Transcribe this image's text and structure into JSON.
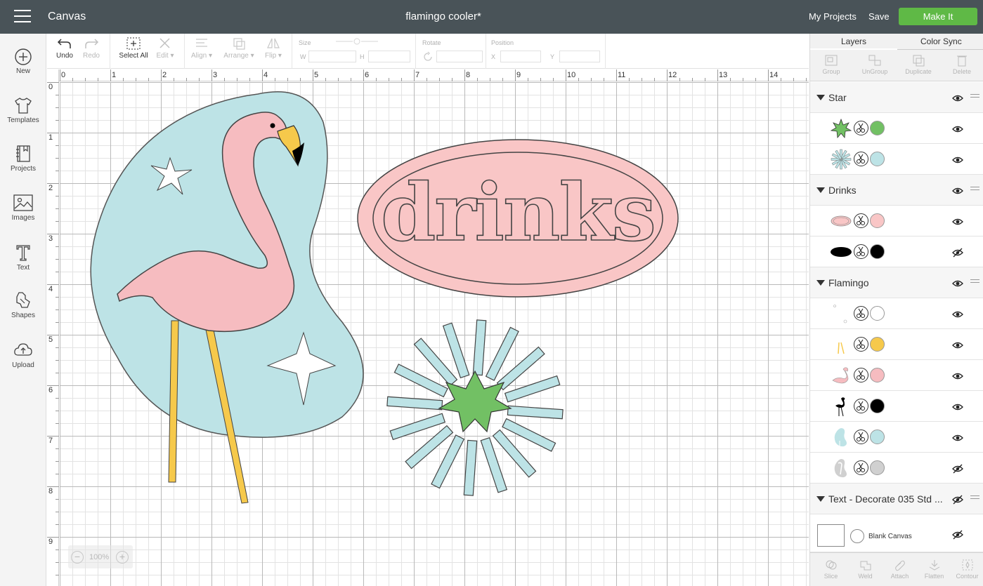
{
  "topbar": {
    "app_title": "Canvas",
    "doc_title": "flamingo cooler*",
    "my_projects": "My Projects",
    "save": "Save",
    "make_it": "Make It"
  },
  "left_nav": [
    {
      "label": "New",
      "icon": "plus-circle-icon"
    },
    {
      "label": "Templates",
      "icon": "tshirt-icon"
    },
    {
      "label": "Projects",
      "icon": "book-icon"
    },
    {
      "label": "Images",
      "icon": "image-icon"
    },
    {
      "label": "Text",
      "icon": "text-t-icon"
    },
    {
      "label": "Shapes",
      "icon": "shapes-icon"
    },
    {
      "label": "Upload",
      "icon": "cloud-upload-icon"
    }
  ],
  "toolbar": {
    "undo": "Undo",
    "redo": "Redo",
    "select_all": "Select All",
    "edit": "Edit",
    "align": "Align",
    "arrange": "Arrange",
    "flip": "Flip",
    "size": "Size",
    "w": "W",
    "h": "H",
    "rotate": "Rotate",
    "position": "Position",
    "x": "X",
    "y": "Y"
  },
  "canvas": {
    "ruler_top": [
      "0",
      "1",
      "2",
      "3",
      "4",
      "5",
      "6",
      "7",
      "8",
      "9",
      "10",
      "11",
      "12",
      "13",
      "14"
    ],
    "ruler_left": [
      "0",
      "1",
      "2",
      "3",
      "4",
      "5",
      "6",
      "7",
      "8",
      "9"
    ],
    "drinks_text": "drinks",
    "zoom_level": "100%",
    "colors": {
      "blob": "#bde3e6",
      "flamingo": "#f6bcc0",
      "beak": "#f6c94b",
      "legs": "#f6c94b",
      "drinks": "#f9c6c6",
      "burst": "#bde3e6",
      "star": "#72c064"
    }
  },
  "right_panel": {
    "tabs": [
      "Layers",
      "Color Sync"
    ],
    "actions": [
      "Group",
      "UnGroup",
      "Duplicate",
      "Delete"
    ],
    "groups": [
      {
        "name": "Star",
        "children": [
          {
            "thumb": "green-star",
            "color": "#72c064",
            "hidden": false
          },
          {
            "thumb": "blue-burst",
            "color": "#bde3e6",
            "hidden": false
          }
        ]
      },
      {
        "name": "Drinks",
        "children": [
          {
            "thumb": "drinks-oval",
            "color": "#f9c6c6",
            "hidden": false
          },
          {
            "thumb": "black-oval",
            "color": "#000000",
            "hidden": true
          }
        ]
      },
      {
        "name": "Flamingo",
        "children": [
          {
            "thumb": "white-stars",
            "color": "#ffffff",
            "hidden": false
          },
          {
            "thumb": "yellow-legs",
            "color": "#f6c94b",
            "hidden": false
          },
          {
            "thumb": "pink-flamingo",
            "color": "#f6bcc0",
            "hidden": false
          },
          {
            "thumb": "black-flamingo",
            "color": "#000000",
            "hidden": false
          },
          {
            "thumb": "blue-blob",
            "color": "#bde3e6",
            "hidden": false
          },
          {
            "thumb": "gray-blob",
            "color": "#d0d0d0",
            "hidden": true
          }
        ]
      },
      {
        "name": "Text - Decorate 035 Std ...",
        "children": []
      }
    ],
    "blank_canvas": "Blank Canvas",
    "bottom_actions": [
      "Slice",
      "Weld",
      "Attach",
      "Flatten",
      "Contour"
    ]
  }
}
